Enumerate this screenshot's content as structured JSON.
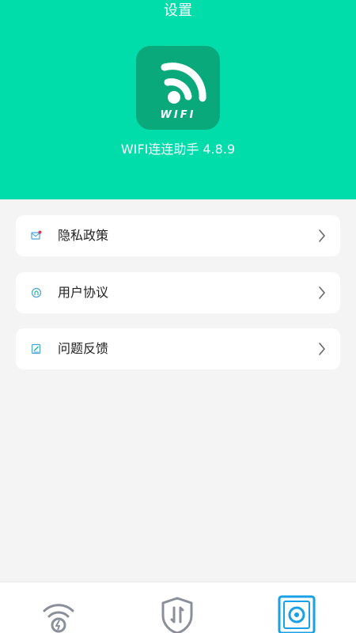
{
  "header": {
    "title": "设置",
    "app_name_version": "WIFI连连助手  4.8.9",
    "logo_text": "WIFI"
  },
  "menu": {
    "items": [
      {
        "label": "隐私政策",
        "icon": "mail-icon"
      },
      {
        "label": "用户协议",
        "icon": "user-agreement-icon"
      },
      {
        "label": "问题反馈",
        "icon": "feedback-icon"
      }
    ]
  },
  "tabbar": {
    "items": [
      {
        "icon": "wifi-boost-icon",
        "active": false
      },
      {
        "icon": "shield-speed-icon",
        "active": false
      },
      {
        "icon": "speaker-device-icon",
        "active": true
      }
    ]
  },
  "colors": {
    "brand": "#00dcaa",
    "logo_bg": "#0aa97b",
    "active_tab": "#1aa0e6",
    "inactive_tab": "#8a8f99"
  }
}
